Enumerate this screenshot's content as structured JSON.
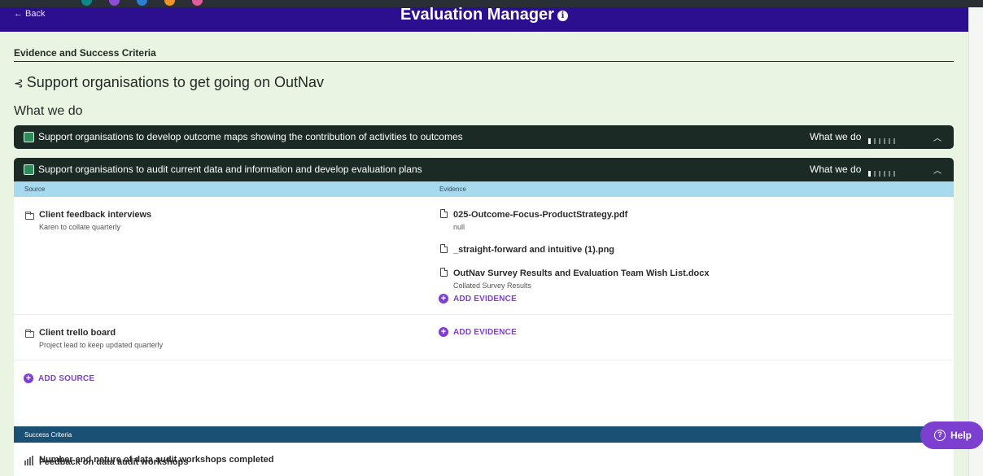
{
  "header": {
    "back_label": "← Back",
    "title": "Evaluation Manager",
    "info_icon": "info-icon"
  },
  "section": {
    "label": "Evidence and Success Criteria",
    "outcome_title": "Support organisations to get going on OutNav",
    "what_we_do": "What we do"
  },
  "activities": [
    {
      "label": "Support organisations to develop outcome maps showing the contribution of activities to outcomes",
      "status_label": "What we do",
      "progress": 0.1
    },
    {
      "label": "Support organisations to audit current data and information and develop evaluation plans",
      "status_label": "What we do",
      "progress": 0.1
    }
  ],
  "columns": {
    "source": "Source",
    "evidence": "Evidence"
  },
  "sources": [
    {
      "name": "Client feedback interviews",
      "note": "Karen to collate quarterly",
      "evidence": [
        {
          "name": "025-Outcome-Focus-ProductStrategy.pdf",
          "note": "null"
        },
        {
          "name": "_straight-forward and intuitive (1).png",
          "note": ""
        },
        {
          "name": "OutNav Survey Results and Evaluation Team Wish List.docx",
          "note": "Collated Survey Results"
        }
      ],
      "add_evidence": "ADD EVIDENCE"
    },
    {
      "name": "Client trello board",
      "note": "Project lead to keep updated quarterly",
      "evidence": [],
      "add_evidence": "ADD EVIDENCE"
    }
  ],
  "add_source": "ADD SOURCE",
  "success_criteria": {
    "heading": "Success Criteria",
    "items": [
      "Number and nature of data audit workshops completed",
      "Feedback on data audit workshops"
    ]
  },
  "help": {
    "label": "Help"
  },
  "colors": {
    "header_bg": "#2c0f8e",
    "activity_bg": "#1b2a24",
    "accent": "#7e3ed6",
    "column_header": "#a8daef",
    "success_bar": "#1a5073",
    "page_bg": "#e9f4e3"
  }
}
